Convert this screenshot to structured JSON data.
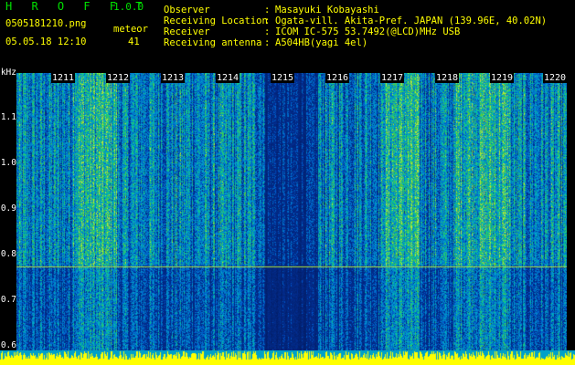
{
  "app": {
    "name": "H R O F F T",
    "version": "1.0.0"
  },
  "file": {
    "name": "0505181210.png",
    "datetime": "05.05.18 12:10"
  },
  "meteor": {
    "label": "meteor",
    "count": "41"
  },
  "info": [
    {
      "key": "Observer",
      "sep": ":",
      "value": "Masayuki Kobayashi"
    },
    {
      "key": "Receiving Location",
      "sep": ":",
      "value": "Ogata-vill. Akita-Pref. JAPAN (139.96E, 40.02N)"
    },
    {
      "key": "Receiver",
      "sep": ":",
      "value": "ICOM IC-575 53.7492(@LCD)MHz USB"
    },
    {
      "key": "Receiving antenna",
      "sep": ":",
      "value": "A504HB(yagi 4el)"
    }
  ],
  "axis": {
    "unit": "kHz",
    "y_ticks": [
      "1.1",
      "1.0",
      "0.9",
      "0.8",
      "0.7",
      "0.6"
    ],
    "time_ticks": [
      "1211",
      "1212",
      "1213",
      "1214",
      "1215",
      "1216",
      "1217",
      "1218",
      "1219",
      "1220"
    ]
  },
  "colors": {
    "title": "#00e000",
    "info": "#ffff00",
    "background": "#000000",
    "spectrum_base": "#02154f"
  }
}
